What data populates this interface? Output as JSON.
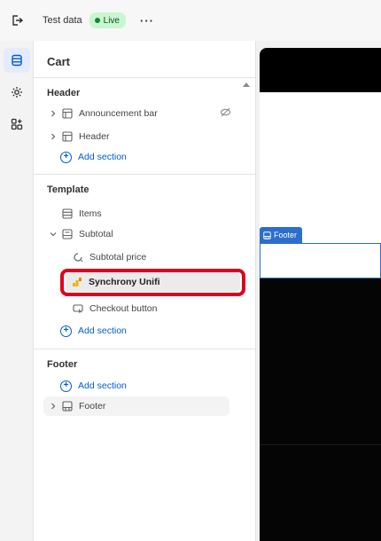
{
  "topbar": {
    "store_name": "Test data",
    "status_badge": "Live",
    "more_label": "···"
  },
  "panel": {
    "title": "Cart",
    "header_group": {
      "title": "Header",
      "items": [
        {
          "label": "Announcement bar",
          "icon": "section-layout-icon",
          "hidden": true
        },
        {
          "label": "Header",
          "icon": "section-layout-icon"
        }
      ],
      "add_label": "Add section"
    },
    "template_group": {
      "title": "Template",
      "items": [
        {
          "label": "Items",
          "icon": "section-items-icon"
        },
        {
          "label": "Subtotal",
          "icon": "section-subtotal-icon",
          "expanded": true
        },
        {
          "label": "Subtotal price",
          "icon": "block-price-icon"
        },
        {
          "label": "Synchrony Unifi",
          "icon": "app-block-icon",
          "highlighted": true
        },
        {
          "label": "Checkout button",
          "icon": "block-button-icon"
        }
      ],
      "add_label": "Add section"
    },
    "footer_group": {
      "title": "Footer",
      "add_label": "Add section",
      "items": [
        {
          "label": "Footer",
          "icon": "section-footer-icon"
        }
      ]
    }
  },
  "preview": {
    "footer_tag_label": "Footer"
  },
  "colors": {
    "accent": "#005bd3",
    "live_badge_bg": "#c8f7cf",
    "highlight": "#e0001b",
    "preview_tag": "#2c6ecb"
  }
}
